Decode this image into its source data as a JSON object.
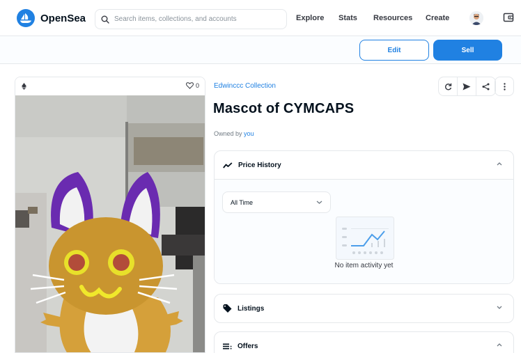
{
  "nav": {
    "brand": "OpenSea",
    "search_placeholder": "Search items, collections, and accounts",
    "links": [
      "Explore",
      "Stats",
      "Resources",
      "Create"
    ]
  },
  "actions": {
    "edit_label": "Edit",
    "sell_label": "Sell"
  },
  "asset": {
    "favorite_count": "0",
    "collection": "Edwinccc Collection",
    "title": "Mascot of CYMCAPS",
    "owned_by_prefix": "Owned by",
    "owner": "you"
  },
  "price_history": {
    "title": "Price History",
    "period": "All Time",
    "empty_text": "No item activity yet"
  },
  "listings": {
    "title": "Listings"
  },
  "offers": {
    "title": "Offers"
  },
  "colors": {
    "accent": "#2081e2",
    "text": "#04111d",
    "border": "#e5e8eb"
  }
}
